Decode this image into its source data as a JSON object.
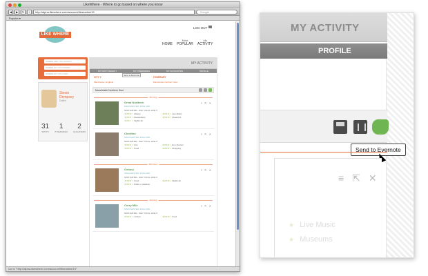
{
  "browser": {
    "window_title": "LikeWhere · Where to go based on where you know",
    "url": "http://alpha.likewhere.com/account/itineraries/19",
    "search_placeholder": "Google",
    "bookmarks_label": "Popular ▾",
    "status_text": "Go to \"http://alpha.likewhere.com/account/itineraries/19\""
  },
  "site": {
    "logo_text": "LIKE WHERE",
    "logout_label": "LOG OUT",
    "nav": [
      {
        "sub": "",
        "label": "HOME"
      },
      {
        "sub": "Most",
        "label": "POPULAR"
      },
      {
        "sub": "My",
        "label": "ACTIVITY"
      }
    ]
  },
  "search_widget": {
    "fields": [
      "WHERE ARE YOU GOING?",
      "WHERE DO YOU KNOW?",
      "WHERE DO YOU LIKE?"
    ]
  },
  "profile": {
    "name_first": "Simon",
    "name_last": "Dempsey",
    "location": "Dublin",
    "stats": [
      {
        "value": "31",
        "label": "SPOTS"
      },
      {
        "value": "1",
        "label": "ITINERARIES"
      },
      {
        "value": "2",
        "label": "QUALIFIERS"
      }
    ]
  },
  "main": {
    "header_title": "MY ACTIVITY",
    "subtabs": [
      "MY MOST RECENT",
      "MY ITINERARIES",
      "MY FAVOURITES",
      "PROFILE"
    ],
    "city_label": "CITY",
    "city_value": "Manchester, England",
    "itinerary_label": "ITINERARY",
    "itinerary_value": "Manchester Northern Soul",
    "itinerary_name": "Manchester Northern Soul",
    "tooltip": "Send to Evernote",
    "sections": [
      "Morning",
      "Afternoon",
      "Evening"
    ],
    "spot_rating_label": "SPOT RATING · WHY YOU'LL LIKE IT",
    "places": [
      {
        "name": "Great Northern",
        "location": "MANCHESTER, ENGLAND",
        "tags": [
          "History",
          "Live Music",
          "Restaurants",
          "Museums",
          "Night Life"
        ]
      },
      {
        "name": "Chorlton",
        "location": "MANCHESTER, ENGLAND",
        "tags": [
          "Arts",
          "Eco-Tourism",
          "Food",
          "Shopping"
        ]
      },
      {
        "name": "Oxbury",
        "location": "MANCHESTER, ENGLAND",
        "tags": [
          "Food",
          "Night Life",
          "Parks + Gardens"
        ]
      },
      {
        "name": "Curry Mile",
        "location": "MANCHESTER, ENGLAND",
        "tags": [
          "Culture",
          "Food"
        ]
      }
    ]
  },
  "zoom": {
    "activity_label": "MY ACTIVITY",
    "profile_label": "PROFILE",
    "tooltip": "Send to Evernote",
    "tags": [
      "Live Music",
      "Museums"
    ]
  },
  "colors": {
    "brand_orange": "#e46a3a",
    "brand_teal": "#7fc6c5",
    "evernote_green": "#6fb653",
    "rating_star": "#9bbf53"
  }
}
